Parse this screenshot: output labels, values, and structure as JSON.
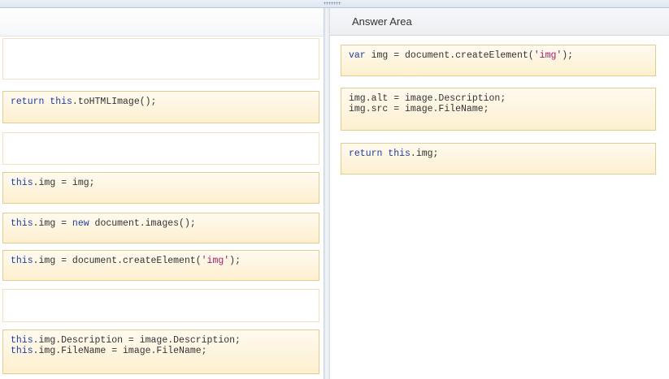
{
  "answer_area": {
    "title": "Answer Area"
  },
  "source_tiles": [
    {
      "tokens": []
    },
    {
      "tokens": [
        {
          "t": "return this",
          "k": "kw"
        },
        {
          "t": ".toHTMLImage();",
          "k": ""
        }
      ]
    },
    {
      "tokens": []
    },
    {
      "tokens": [
        {
          "t": "this",
          "k": "kw"
        },
        {
          "t": ".img = img;",
          "k": ""
        }
      ]
    },
    {
      "tokens": [
        {
          "t": "this",
          "k": "kw"
        },
        {
          "t": ".img = ",
          "k": ""
        },
        {
          "t": "new",
          "k": "kw"
        },
        {
          "t": " document.images();",
          "k": ""
        }
      ]
    },
    {
      "tokens": [
        {
          "t": "this",
          "k": "kw"
        },
        {
          "t": ".img = document.createElement(",
          "k": ""
        },
        {
          "t": "'img'",
          "k": "str"
        },
        {
          "t": ");",
          "k": ""
        }
      ]
    },
    {
      "tokens": []
    },
    {
      "tokens": [
        {
          "t": "this",
          "k": "kw"
        },
        {
          "t": ".img.Description = image.Description;\n",
          "k": ""
        },
        {
          "t": "this",
          "k": "kw"
        },
        {
          "t": ".img.FileName = image.FileName;",
          "k": ""
        }
      ]
    }
  ],
  "answer_tiles": [
    {
      "tokens": [
        {
          "t": "var",
          "k": "kw"
        },
        {
          "t": " img = document.createElement(",
          "k": ""
        },
        {
          "t": "'img'",
          "k": "str"
        },
        {
          "t": ");",
          "k": ""
        }
      ]
    },
    {
      "tokens": [
        {
          "t": "img.alt = image.Description;\nimg.src = image.FileName;",
          "k": ""
        }
      ]
    },
    {
      "tokens": [
        {
          "t": "return this",
          "k": "kw"
        },
        {
          "t": ".img;",
          "k": ""
        }
      ]
    }
  ],
  "colors": {
    "keyword": "#1f3fa0",
    "string": "#a0206a",
    "tile_fill": "#fdf0cf",
    "tile_border": "#e3cc8c"
  }
}
